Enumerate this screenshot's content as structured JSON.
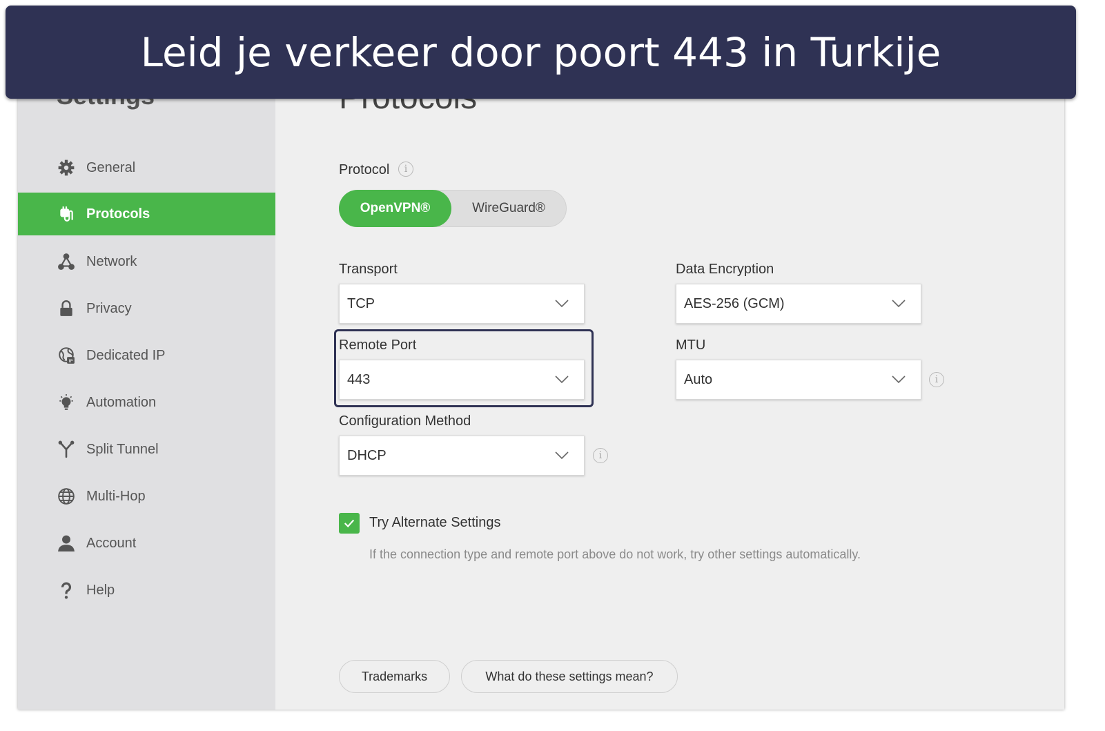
{
  "banner": {
    "text": "Leid je verkeer door poort 443 in Turkije"
  },
  "sidebar": {
    "title": "Settings",
    "items": [
      {
        "label": "General",
        "icon": "gear-icon",
        "active": false
      },
      {
        "label": "Protocols",
        "icon": "protocol-plug-icon",
        "active": true
      },
      {
        "label": "Network",
        "icon": "network-icon",
        "active": false
      },
      {
        "label": "Privacy",
        "icon": "lock-icon",
        "active": false
      },
      {
        "label": "Dedicated IP",
        "icon": "dedicated-ip-icon",
        "active": false
      },
      {
        "label": "Automation",
        "icon": "lightbulb-icon",
        "active": false
      },
      {
        "label": "Split Tunnel",
        "icon": "split-tunnel-icon",
        "active": false
      },
      {
        "label": "Multi-Hop",
        "icon": "globe-icon",
        "active": false
      },
      {
        "label": "Account",
        "icon": "user-icon",
        "active": false
      },
      {
        "label": "Help",
        "icon": "question-icon",
        "active": false
      }
    ]
  },
  "main": {
    "title": "Protocols",
    "protocol": {
      "label": "Protocol",
      "options": [
        "OpenVPN®",
        "WireGuard®"
      ],
      "selected": "OpenVPN®"
    },
    "transport": {
      "label": "Transport",
      "value": "TCP"
    },
    "remote_port": {
      "label": "Remote Port",
      "value": "443"
    },
    "configuration_method": {
      "label": "Configuration Method",
      "value": "DHCP"
    },
    "data_encryption": {
      "label": "Data Encryption",
      "value": "AES-256 (GCM)"
    },
    "mtu": {
      "label": "MTU",
      "value": "Auto"
    },
    "alternate": {
      "label": "Try Alternate Settings",
      "checked": true,
      "description": "If the connection type and remote port above do not work, try other settings automatically."
    },
    "buttons": {
      "trademarks": "Trademarks",
      "help": "What do these settings mean?"
    }
  },
  "colors": {
    "accent": "#49b64a",
    "banner": "#2f3254",
    "sidebar": "#e0e0e2",
    "panel": "#efefef"
  }
}
